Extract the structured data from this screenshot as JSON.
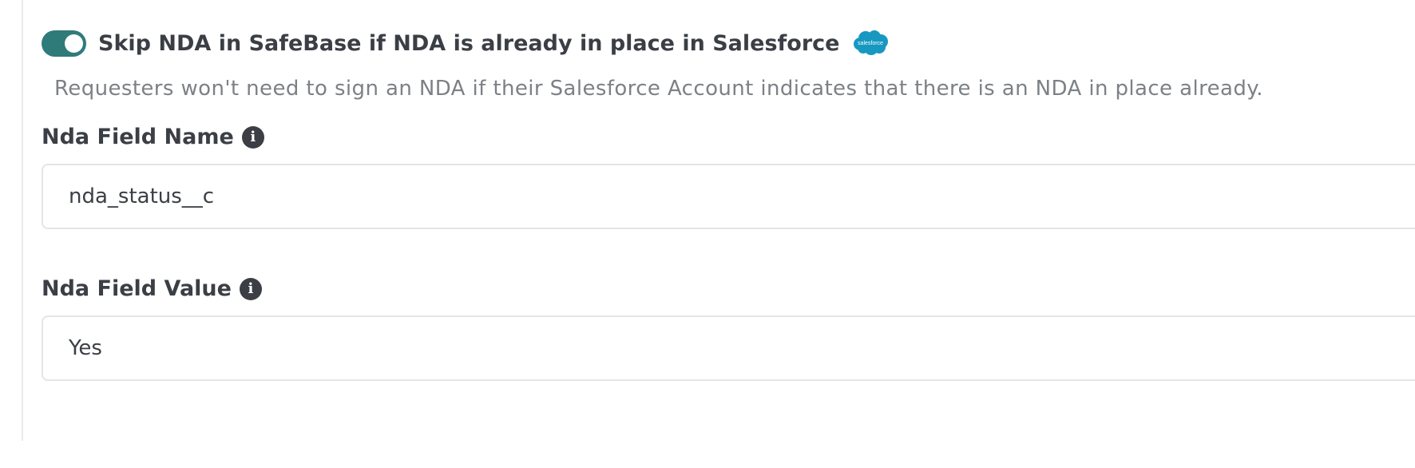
{
  "toggle": {
    "label": "Skip NDA in SafeBase if NDA is already in place in Salesforce",
    "state": "on",
    "color": "#2f7b7a",
    "icon": "salesforce-logo",
    "logo_text": "salesforce"
  },
  "description": "Requesters won't need to sign an NDA if their Salesforce Account indicates that there is an NDA in place already.",
  "fields": [
    {
      "label": "Nda Field Name",
      "value": "nda_status__c",
      "info_icon": "info-icon"
    },
    {
      "label": "Nda Field Value",
      "value": "Yes",
      "info_icon": "info-icon"
    }
  ]
}
